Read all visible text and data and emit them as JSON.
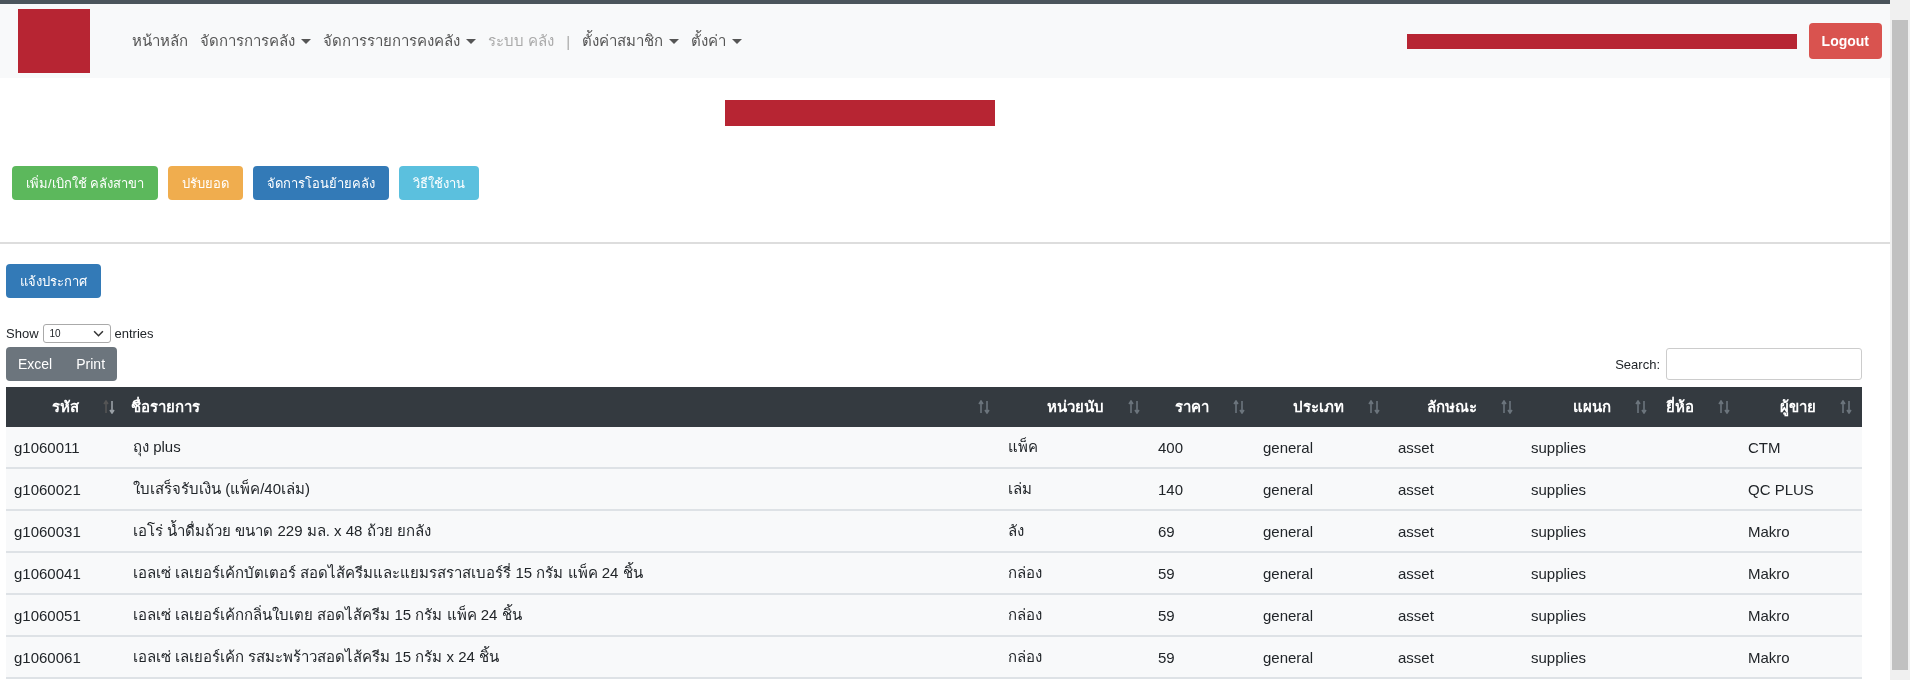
{
  "navbar": {
    "items": [
      {
        "kind": "link",
        "label": "หน้าหลัก",
        "dropdown": false,
        "disabled": false
      },
      {
        "kind": "link",
        "label": "จัดการการคลัง",
        "dropdown": true,
        "disabled": false
      },
      {
        "kind": "link",
        "label": "จัดการรายการคงคลัง",
        "dropdown": true,
        "disabled": false
      },
      {
        "kind": "link",
        "label": "ระบบ คลัง",
        "dropdown": false,
        "disabled": true
      },
      {
        "kind": "separator",
        "label": "|"
      },
      {
        "kind": "link",
        "label": "ตั้งค่าสมาชิก",
        "dropdown": true,
        "disabled": false
      },
      {
        "kind": "link",
        "label": "ตั้งค่า",
        "dropdown": true,
        "disabled": false
      }
    ],
    "logout": "Logout"
  },
  "actions": [
    {
      "label": "เพิ่ม/เบิกใช้ คลังสาขา",
      "kind": "success"
    },
    {
      "label": "ปรับยอด",
      "kind": "warning"
    },
    {
      "label": "จัดการโอนย้ายคลัง",
      "kind": "primary"
    },
    {
      "label": "วิธีใช้งาน",
      "kind": "info"
    }
  ],
  "announce_button": "แจ้งประกาศ",
  "length": {
    "before": "Show",
    "value": "10",
    "after": "entries"
  },
  "export_buttons": [
    "Excel",
    "Print"
  ],
  "search": {
    "label": "Search:"
  },
  "table": {
    "columns": [
      {
        "label": "รหัส",
        "sorted": true
      },
      {
        "label": "ชื่อรายการ",
        "sorted": false
      },
      {
        "label": "หน่วยนับ",
        "sorted": false
      },
      {
        "label": "ราคา",
        "sorted": false
      },
      {
        "label": "ประเภท",
        "sorted": false
      },
      {
        "label": "ลักษณะ",
        "sorted": false
      },
      {
        "label": "แผนก",
        "sorted": false
      },
      {
        "label": "ยี่ห้อ",
        "sorted": false
      },
      {
        "label": "ผู้ขาย",
        "sorted": false
      }
    ],
    "rows": [
      [
        "g1060011",
        "ถุง plus",
        "แพ็ค",
        "400",
        "general",
        "asset",
        "supplies",
        "",
        "CTM"
      ],
      [
        "g1060021",
        "ใบเสร็จรับเงิน (แพ็ค/40เล่ม)",
        "เล่ม",
        "140",
        "general",
        "asset",
        "supplies",
        "",
        "QC PLUS"
      ],
      [
        "g1060031",
        "เอโร่ น้ำดื่มถ้วย ขนาด 229 มล. x 48 ถ้วย ยกลัง",
        "ลัง",
        "69",
        "general",
        "asset",
        "supplies",
        "",
        "Makro"
      ],
      [
        "g1060041",
        "เอลเซ่ เลเยอร์เค้กบัตเตอร์ สอดไส้ครีมและแยมรสราสเบอร์รี่ 15 กรัม แพ็ค 24 ชิ้น",
        "กล่อง",
        "59",
        "general",
        "asset",
        "supplies",
        "",
        "Makro"
      ],
      [
        "g1060051",
        "เอลเซ่ เลเยอร์เค้กกลิ่นใบเตย สอดไส้ครีม 15 กรัม แพ็ค 24 ชิ้น",
        "กล่อง",
        "59",
        "general",
        "asset",
        "supplies",
        "",
        "Makro"
      ],
      [
        "g1060061",
        "เอลเซ่ เลเยอร์เค้ก รสมะพร้าวสอดไส้ครีม 15 กรัม x 24 ชิ้น",
        "กล่อง",
        "59",
        "general",
        "asset",
        "supplies",
        "",
        "Makro"
      ]
    ]
  }
}
